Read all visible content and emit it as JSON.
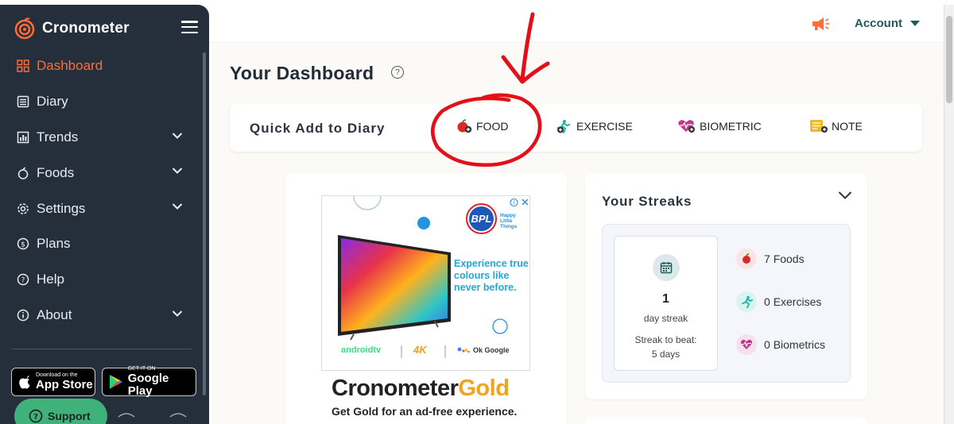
{
  "app": {
    "name": "Cronometer"
  },
  "colors": {
    "sidebar": "#252f3c",
    "accent": "#ff6c35",
    "teal": "#1f5c5a",
    "gold": "#f4a21b",
    "support": "#3fb17a"
  },
  "sidebar": {
    "items": [
      {
        "label": "Dashboard",
        "icon": "dashboard-icon",
        "active": true
      },
      {
        "label": "Diary",
        "icon": "diary-icon"
      },
      {
        "label": "Trends",
        "icon": "trends-icon",
        "expandable": true
      },
      {
        "label": "Foods",
        "icon": "apple-icon",
        "expandable": true
      },
      {
        "label": "Settings",
        "icon": "gear-icon",
        "expandable": true
      },
      {
        "label": "Plans",
        "icon": "dollar-icon"
      },
      {
        "label": "Help",
        "icon": "help-icon"
      },
      {
        "label": "About",
        "icon": "info-icon",
        "expandable": true
      }
    ],
    "app_store": {
      "small": "Download on the",
      "big": "App Store"
    },
    "google_play": {
      "small": "GET IT ON",
      "big": "Google Play"
    },
    "support_label": "Support"
  },
  "header": {
    "account_label": "Account"
  },
  "main": {
    "title": "Your Dashboard",
    "quick_add": {
      "title": "Quick Add to Diary",
      "items": [
        {
          "label": "FOOD",
          "icon": "food-add-icon"
        },
        {
          "label": "EXERCISE",
          "icon": "exercise-add-icon"
        },
        {
          "label": "BIOMETRIC",
          "icon": "biometric-add-icon"
        },
        {
          "label": "NOTE",
          "icon": "note-add-icon"
        }
      ]
    },
    "ad": {
      "brand": "BPL",
      "tagline_small": "Happy Little Things",
      "headline": "Experience true colours like never before.",
      "partners": [
        "androidtv",
        "4K",
        "Ok Google"
      ],
      "gold_title_a": "Cronometer",
      "gold_title_b": "Gold",
      "gold_sub": "Get Gold for an ad-free experience."
    },
    "streaks": {
      "title": "Your Streaks",
      "count": "1",
      "count_label": "day streak",
      "beat_label": "Streak to beat:",
      "beat_value": "5 days",
      "stats": [
        {
          "value": "7",
          "label": "Foods"
        },
        {
          "value": "0",
          "label": "Exercises"
        },
        {
          "value": "0",
          "label": "Biometrics"
        }
      ]
    }
  }
}
